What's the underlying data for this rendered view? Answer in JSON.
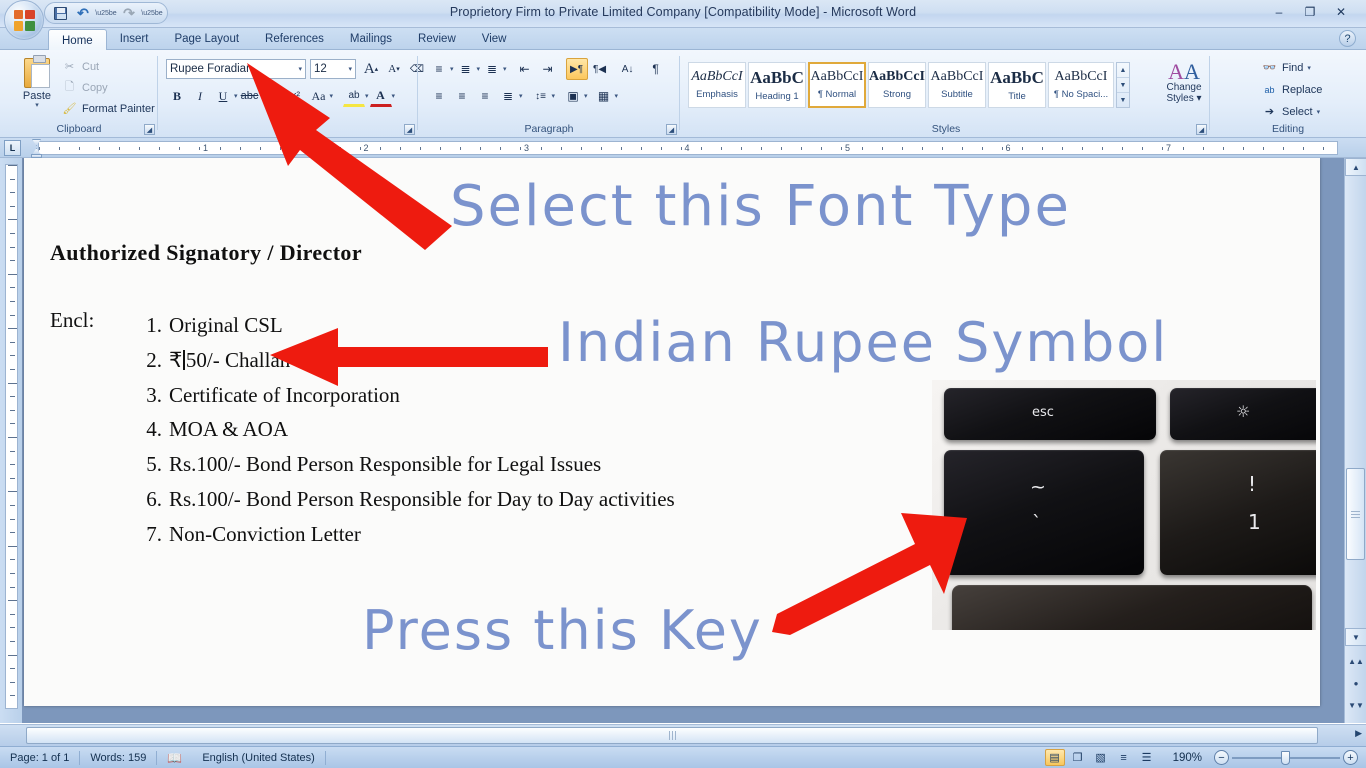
{
  "window": {
    "title": "Proprietory Firm to Private Limited Company [Compatibility Mode]  -  Microsoft Word",
    "minimize": "–",
    "restore": "❐",
    "close": "✕",
    "help": "?"
  },
  "quick_access": {
    "save": "save-icon",
    "undo": "↶",
    "redo": "↷",
    "customize": "▾"
  },
  "tabs": [
    {
      "label": "Home",
      "active": true
    },
    {
      "label": "Insert",
      "active": false
    },
    {
      "label": "Page Layout",
      "active": false
    },
    {
      "label": "References",
      "active": false
    },
    {
      "label": "Mailings",
      "active": false
    },
    {
      "label": "Review",
      "active": false
    },
    {
      "label": "View",
      "active": false
    }
  ],
  "ribbon": {
    "clipboard": {
      "label": "Clipboard",
      "paste": "Paste",
      "cut": "Cut",
      "copy": "Copy",
      "format_painter": "Format Painter"
    },
    "font": {
      "label": "Font",
      "font_name": "Rupee Foradian",
      "font_size": "12",
      "grow": "A",
      "shrink": "A",
      "clear_formatting": "Aa",
      "bold": "B",
      "italic": "I",
      "underline": "U",
      "strikethrough": "abc",
      "subscript": "X₂",
      "change_case": "Aa",
      "highlight": "ab",
      "font_color": "A"
    },
    "paragraph": {
      "label": "Paragraph",
      "bullets": "≡",
      "numbering": "≣",
      "multilevel": "≣",
      "decrease_indent": "⇤",
      "increase_indent": "⇥",
      "ltr": "¶",
      "rtl": "¶",
      "sort": "A↓",
      "show_marks": "¶",
      "align_left": "≡",
      "align_center": "≡",
      "align_right": "≡",
      "justify": "≡",
      "line_spacing": "↕",
      "shading": "▣",
      "borders": "▦"
    },
    "styles": {
      "label": "Styles",
      "items": [
        {
          "preview": "AaBbCcI",
          "name": "Emphasis",
          "selected": false
        },
        {
          "preview": "AaBbC",
          "name": "Heading 1",
          "selected": false
        },
        {
          "preview": "AaBbCcI",
          "name": "¶ Normal",
          "selected": true
        },
        {
          "preview": "AaBbCcI",
          "name": "Strong",
          "selected": false
        },
        {
          "preview": "AaBbCcI",
          "name": "Subtitle",
          "selected": false
        },
        {
          "preview": "AaBbC",
          "name": "Title",
          "selected": false
        },
        {
          "preview": "AaBbCcI",
          "name": "¶ No Spaci...",
          "selected": false
        }
      ],
      "change_styles": "Change",
      "change_styles_2": "Styles"
    },
    "editing": {
      "label": "Editing",
      "find": "Find",
      "replace": "Replace",
      "select": "Select"
    }
  },
  "ruler": {
    "tab_selector": "L",
    "h_numbers": [
      "1",
      "2",
      "3",
      "4",
      "5",
      "6",
      "7"
    ]
  },
  "document": {
    "heading": "Authorized  Signatory  / Director",
    "encl_label": "Encl:",
    "items": [
      {
        "num": "1.",
        "text": "Original  CSL"
      },
      {
        "num": "2.",
        "text": "₹",
        "text_after": "50/- Challan",
        "has_caret": true
      },
      {
        "num": "3.",
        "text": "Certificate  of Incorporation"
      },
      {
        "num": "4.",
        "text": "MOA & AOA"
      },
      {
        "num": "5.",
        "text": "Rs.100/- Bond Person Responsible  for Legal Issues"
      },
      {
        "num": "6.",
        "text": "Rs.100/- Bond Person Responsible  for Day to Day activities"
      },
      {
        "num": "7.",
        "text": "Non-Conviction  Letter"
      }
    ]
  },
  "annotations": {
    "select_font": "Select this Font Type",
    "rupee_symbol": "Indian  Rupee  Symbol",
    "press_key": "Press this Key",
    "color": "#7b93cd",
    "arrow_color": "#ee1b0f"
  },
  "keyboard_photo": {
    "esc_key": "esc",
    "brightness_key": "brightness-icon",
    "tilde_key": "~",
    "backtick_key": "`",
    "exclaim_key": "!",
    "one_key": "1"
  },
  "status_bar": {
    "page": "Page: 1 of 1",
    "words": "Words: 159",
    "proofing": "proofing-icon",
    "language": "English (United States)",
    "zoom": "190%",
    "zoom_out": "−",
    "zoom_in": "+",
    "views": [
      {
        "name": "print-layout",
        "glyph": "▤",
        "selected": true
      },
      {
        "name": "full-screen-reading",
        "glyph": "❐",
        "selected": false
      },
      {
        "name": "web-layout",
        "glyph": "▧",
        "selected": false
      },
      {
        "name": "outline",
        "glyph": "≡",
        "selected": false
      },
      {
        "name": "draft",
        "glyph": "☰",
        "selected": false
      }
    ]
  }
}
